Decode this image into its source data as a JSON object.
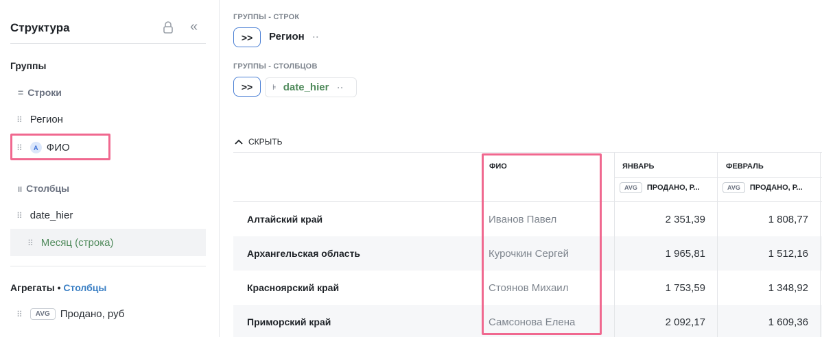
{
  "sidebar": {
    "title": "Структура",
    "groups_label": "Группы",
    "rows_label": "Строки",
    "rows_mark": "=",
    "rows_items": [
      "Регион",
      "ФИО"
    ],
    "fio_badge": "A",
    "cols_label": "Столбцы",
    "cols_mark": "II",
    "cols_items": [
      "date_hier"
    ],
    "month_item": "Месяц (строка)",
    "agg_label": "Агрегаты",
    "agg_sep": "•",
    "agg_cols": "Столбцы",
    "agg_tag": "AVG",
    "agg_item": "Продано, руб"
  },
  "main": {
    "row_groups_label": "ГРУППЫ - СТРОК",
    "row_group_value": "Регион",
    "col_groups_label": "ГРУППЫ - СТОЛБЦОВ",
    "col_group_value": "date_hier",
    "expand_glyph": ">>",
    "more_glyph": "··",
    "hide_label": "СКРЫТЬ"
  },
  "table": {
    "fio_header": "ФИО",
    "month_headers": [
      "ЯНВАРЬ",
      "ФЕВРАЛЬ"
    ],
    "measure_tag": "AVG",
    "measure_label": "ПРОДАНО, Р...",
    "rows": [
      {
        "region": "Алтайский край",
        "fio": "Иванов Павел",
        "jan": "2 351,39",
        "feb": "1 808,77"
      },
      {
        "region": "Архангельская область",
        "fio": "Курочкин Сергей",
        "jan": "1 965,81",
        "feb": "1 512,16"
      },
      {
        "region": "Красноярский край",
        "fio": "Стоянов Михаил",
        "jan": "1 753,59",
        "feb": "1 348,92"
      },
      {
        "region": "Приморский край",
        "fio": "Самсонова Елена",
        "jan": "2 092,17",
        "feb": "1 609,36"
      }
    ]
  },
  "colors": {
    "highlight": "#f0688f",
    "accent_blue": "#4a7fd4",
    "accent_green": "#4f8a5b"
  }
}
